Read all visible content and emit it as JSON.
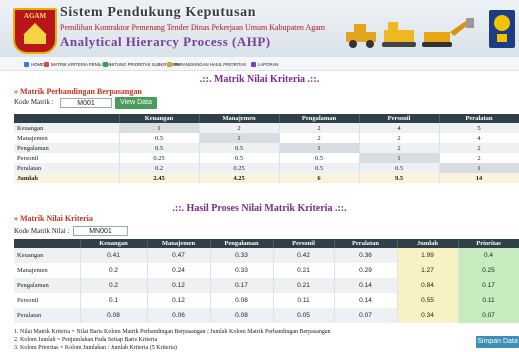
{
  "header": {
    "logo_text": "AGAM",
    "title": "Sistem Pendukung Keputusan",
    "subtitle": "Pemilihan Kontraktor Pemenang Tender Dinas Pekerjaan Umum Kabupaten Agam",
    "subtitle2": "Analytical Hierarcy Process (AHP)"
  },
  "nav": [
    {
      "label": "HOME",
      "icon": "home-icon",
      "color": "#3b7bd6"
    },
    {
      "label": "MATRIK KRITERIA PENILAIAN",
      "icon": "matrix-icon",
      "color": "#d64a3b"
    },
    {
      "label": "HITUNG PRIORITAS SUBKRITERIA",
      "icon": "calc-icon",
      "color": "#3ba14a"
    },
    {
      "label": "PERANGKINGAN HASIL PRIORITAS",
      "icon": "rank-icon",
      "color": "#d6a23b"
    },
    {
      "label": "LAPORAN",
      "icon": "report-icon",
      "color": "#7a3bd6"
    }
  ],
  "section1": {
    "title": ".::. Matrik Nilai Kriteria .::.",
    "sub": "» Matrik Perbandingan Berpasangan",
    "field_label": "Kode Matrik :",
    "field_value": "M001",
    "button": "View Data"
  },
  "table1": {
    "headers": [
      "",
      "Keuangan",
      "Manajemen",
      "Pengalaman",
      "Personil",
      "Peralatan"
    ],
    "rows": [
      [
        "Keuangan",
        "1",
        "2",
        "2",
        "4",
        "5"
      ],
      [
        "Manajemen",
        "0.5",
        "1",
        "2",
        "2",
        "4"
      ],
      [
        "Pengalaman",
        "0.5",
        "0.5",
        "1",
        "2",
        "2"
      ],
      [
        "Personil",
        "0.25",
        "0.5",
        "0.5",
        "1",
        "2"
      ],
      [
        "Peralatan",
        "0.2",
        "0.25",
        "0.5",
        "0.5",
        "1"
      ],
      [
        "Jumlah",
        "2.45",
        "4.25",
        "6",
        "9.5",
        "14"
      ]
    ]
  },
  "section2": {
    "title": ".::. Hasil Proses Nilai Matrik Kriteria .::.",
    "sub": "» Matrik Nilai Kriteria",
    "field_label": "Kode Matrik Nilai :",
    "field_value": "MN001"
  },
  "table2": {
    "headers": [
      "",
      "Keuangan",
      "Manajemen",
      "Pengalaman",
      "Personil",
      "Peralatan",
      "Jumlah",
      "Prioritas"
    ],
    "rows": [
      [
        "Keuangan",
        "0.41",
        "0.47",
        "0.33",
        "0.42",
        "0.36",
        "1.99",
        "0.4"
      ],
      [
        "Manajemen",
        "0.2",
        "0.24",
        "0.33",
        "0.21",
        "0.29",
        "1.27",
        "0.25"
      ],
      [
        "Pengalaman",
        "0.2",
        "0.12",
        "0.17",
        "0.21",
        "0.14",
        "0.84",
        "0.17"
      ],
      [
        "Personil",
        "0.1",
        "0.12",
        "0.08",
        "0.11",
        "0.14",
        "0.55",
        "0.11"
      ],
      [
        "Peralatan",
        "0.08",
        "0.06",
        "0.08",
        "0.05",
        "0.07",
        "0.34",
        "0.07"
      ]
    ]
  },
  "notes": [
    "1. Nilai Matrik Kriteria = Nilai Baris Kolom Matrik Perbandingan Berpasangan / Jumlah Kolom Matrik Perbandingan Berpasangan",
    "2. Kolom Jumlah = Penjumlahan Pada Setiap Baris Kriteria",
    "3. Kolom Prioritas = Kolom Jumlahan / Jumlah Kriteria (5 Kriteria)"
  ],
  "save_button": "Simpan Data"
}
